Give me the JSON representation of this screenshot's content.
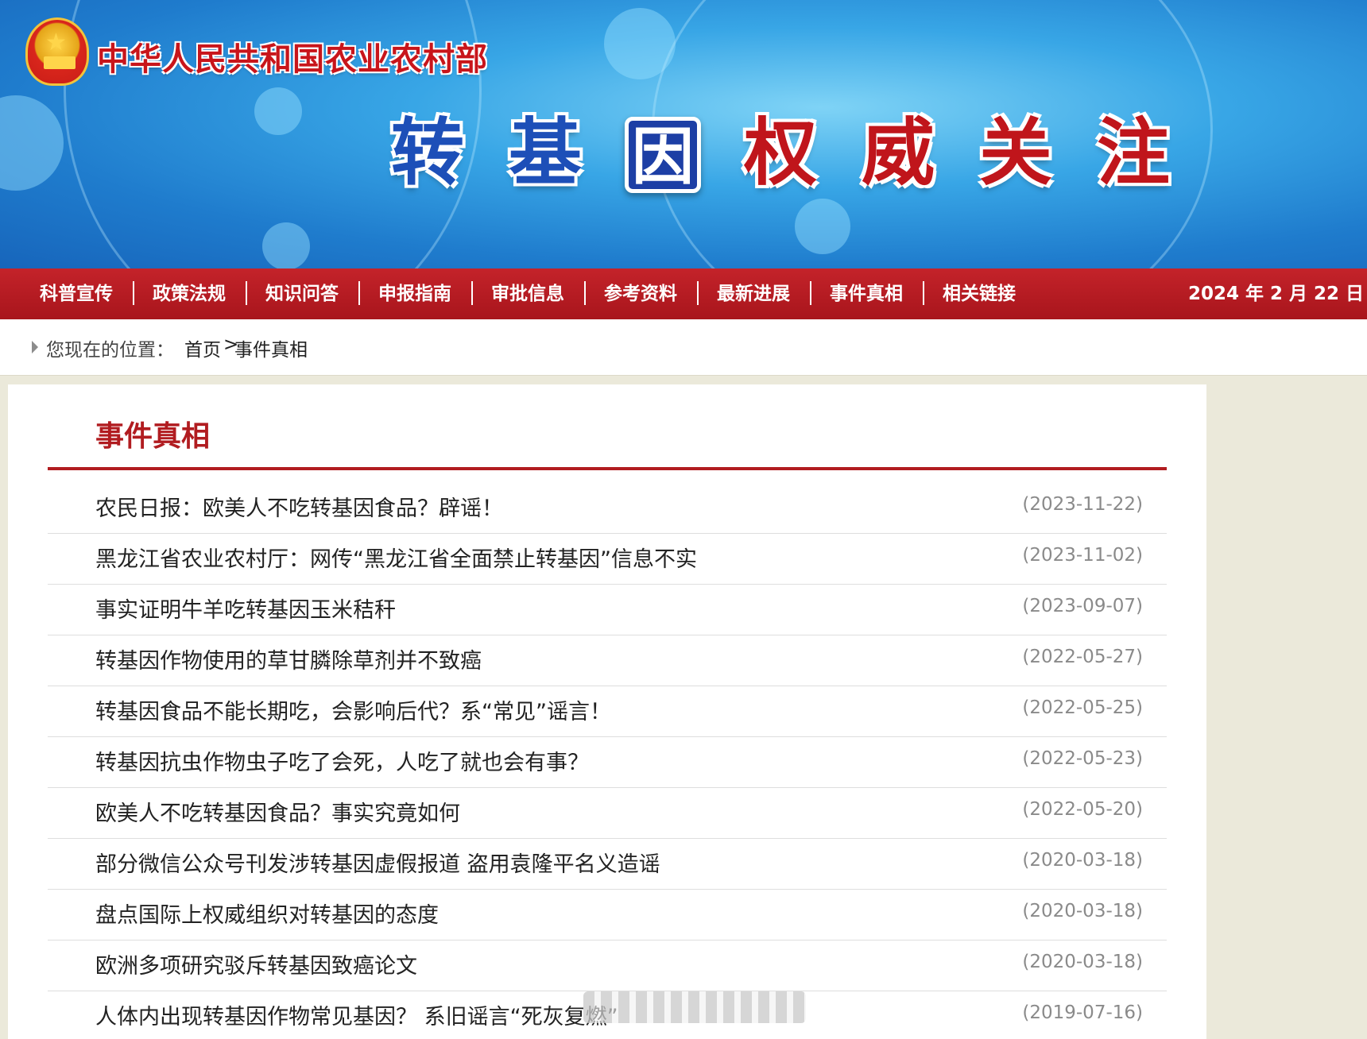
{
  "banner": {
    "ministry_name": "中华人民共和国农业农村部",
    "headline_chars": [
      "转",
      "基",
      "因",
      "权",
      "威",
      "关",
      "注"
    ],
    "headline_colors": [
      "#1d4fb8",
      "#1d4fb8",
      "#ffffff",
      "#c0151b",
      "#c0151b",
      "#c0151b",
      "#c0151b"
    ]
  },
  "nav": {
    "items": [
      "科普宣传",
      "政策法规",
      "知识问答",
      "申报指南",
      "审批信息",
      "参考资料",
      "最新进展",
      "事件真相",
      "相关链接"
    ],
    "date": "2024 年 2 月 22 日"
  },
  "breadcrumb": {
    "label": "您现在的位置：",
    "home": "首页",
    "separator": ">",
    "current": "事件真相"
  },
  "section": {
    "title": "事件真相"
  },
  "news": [
    {
      "title": "农民日报：欧美人不吃转基因食品？辟谣！",
      "date": "(2023-11-22)"
    },
    {
      "title": "黑龙江省农业农村厅：网传“黑龙江省全面禁止转基因”信息不实",
      "date": "(2023-11-02)"
    },
    {
      "title": "事实证明牛羊吃转基因玉米秸秆",
      "date": "(2023-09-07)"
    },
    {
      "title": "转基因作物使用的草甘膦除草剂并不致癌",
      "date": "(2022-05-27)"
    },
    {
      "title": "转基因食品不能长期吃，会影响后代？系“常见”谣言！",
      "date": "(2022-05-25)"
    },
    {
      "title": "转基因抗虫作物虫子吃了会死，人吃了就也会有事？",
      "date": "(2022-05-23)"
    },
    {
      "title": "欧美人不吃转基因食品？事实究竟如何",
      "date": "(2022-05-20)"
    },
    {
      "title": "部分微信公众号刊发涉转基因虚假报道 盗用袁隆平名义造谣",
      "date": "(2020-03-18)"
    },
    {
      "title": "盘点国际上权威组织对转基因的态度",
      "date": "(2020-03-18)"
    },
    {
      "title": "欧洲多项研究驳斥转基因致癌论文",
      "date": "(2020-03-18)"
    },
    {
      "title": "人体内出现转基因作物常见基因？ 系旧谣言“死灰复燃”",
      "date": "(2019-07-16)"
    }
  ],
  "colors": {
    "nav_red": "#b51c22",
    "title_red": "#b11c20",
    "banner_blue": "#2a8fdd",
    "page_bg": "#ebe9da"
  }
}
